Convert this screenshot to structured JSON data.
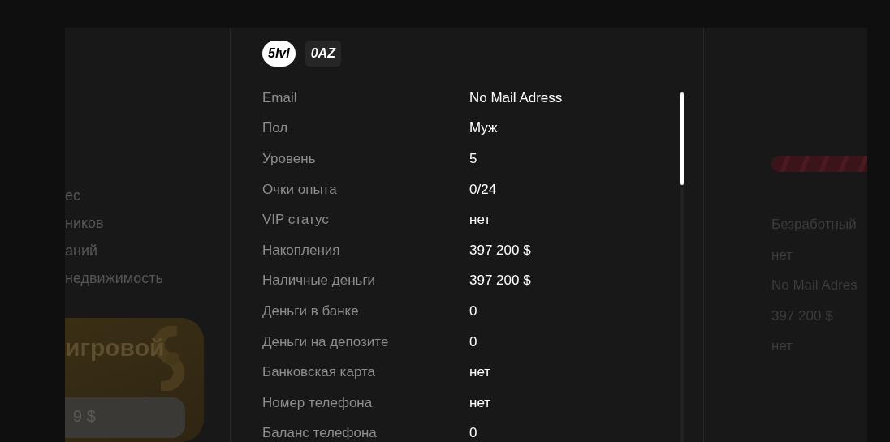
{
  "left_panel": {
    "items": [
      "ес",
      "ников",
      "аний",
      "недвижимость"
    ],
    "promo_card": {
      "title": "игровой",
      "price": "9 $"
    }
  },
  "profile": {
    "badges": [
      {
        "kind": "level",
        "label": "5lvl"
      },
      {
        "kind": "currency",
        "label": "0AZ"
      }
    ],
    "rows": [
      {
        "label": "Email",
        "value": "No Mail Adress"
      },
      {
        "label": "Пол",
        "value": "Муж"
      },
      {
        "label": "Уровень",
        "value": "5"
      },
      {
        "label": "Очки опыта",
        "value": "0/24"
      },
      {
        "label": "VIP статус",
        "value": "нет"
      },
      {
        "label": "Накопления",
        "value": "397 200 $"
      },
      {
        "label": "Наличные деньги",
        "value": "397 200 $"
      },
      {
        "label": "Деньги в банке",
        "value": "0"
      },
      {
        "label": "Деньги на депозите",
        "value": "0"
      },
      {
        "label": "Банковская карта",
        "value": "нет"
      },
      {
        "label": "Номер телефона",
        "value": "нет"
      },
      {
        "label": "Баланс телефона",
        "value": "0"
      }
    ]
  },
  "right_panel": {
    "values": [
      "Безработный",
      "нет",
      "No Mail Adres",
      "397 200 $",
      "нет"
    ]
  }
}
